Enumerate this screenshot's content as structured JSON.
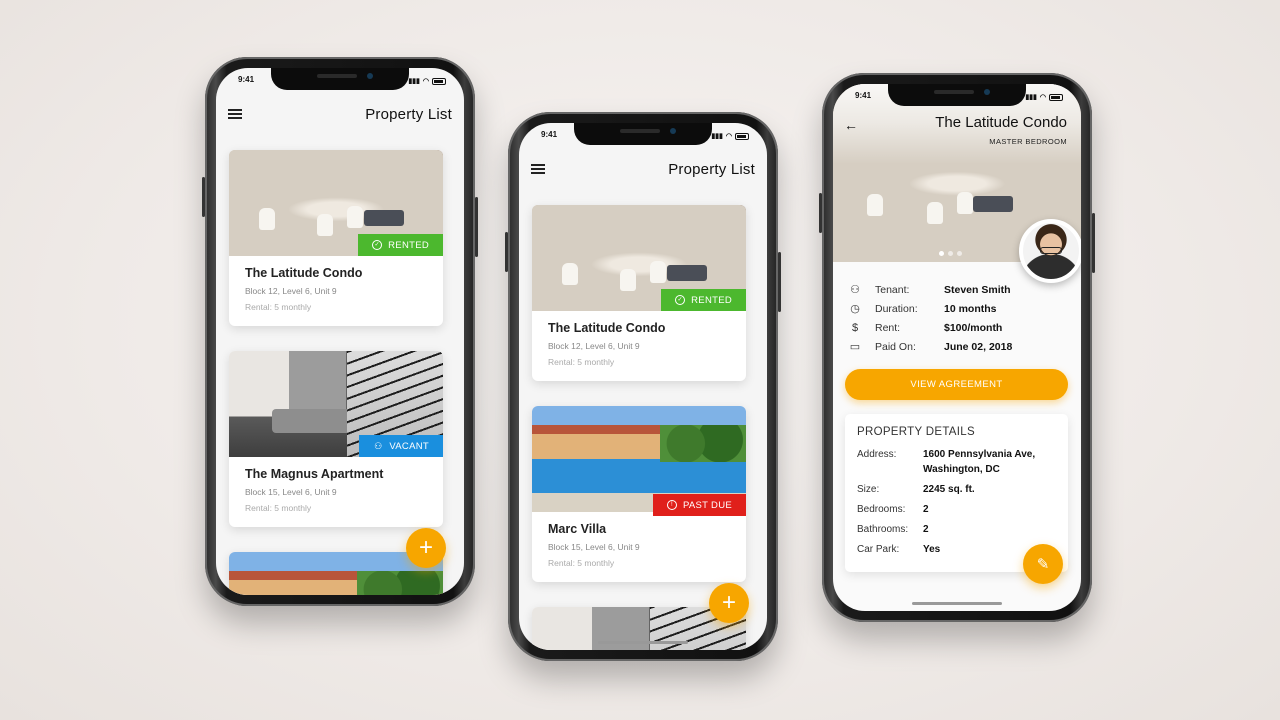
{
  "status_time": "9:41",
  "list_screen": {
    "title": "Property List",
    "cards": [
      {
        "name": "The Latitude Condo",
        "address": "Block 12, Level 6, Unit 9",
        "rental": "Rental: 5 monthly",
        "badge": "RENTED",
        "badge_color": "#4cb82e",
        "badge_icon": "check-circle-icon"
      },
      {
        "name": "The Magnus Apartment",
        "address": "Block 15, Level 6, Unit 9",
        "rental": "Rental: 5 monthly",
        "badge": "VACANT",
        "badge_color": "#1a8fde",
        "badge_icon": "person-icon"
      },
      {
        "name": "Marc Villa",
        "address": "Block 15, Level 6, Unit 9",
        "rental": "Rental: 5 monthly",
        "badge": "PAST DUE",
        "badge_color": "#e0201b",
        "badge_icon": "alert-circle-icon"
      }
    ],
    "fab_label": "+"
  },
  "detail_screen": {
    "title": "The Latitude Condo",
    "subtitle": "MASTER BEDROOM",
    "tenant": [
      {
        "label": "Tenant:",
        "value": "Steven Smith",
        "icon": "person-icon"
      },
      {
        "label": "Duration:",
        "value": "10 months",
        "icon": "clock-icon"
      },
      {
        "label": "Rent:",
        "value": "$100/month",
        "icon": "dollar-icon"
      },
      {
        "label": "Paid On:",
        "value": "June 02, 2018",
        "icon": "card-icon"
      }
    ],
    "button": "VIEW AGREEMENT",
    "details_heading": "PROPERTY DETAILS",
    "details": [
      {
        "label": "Address:",
        "value_line1": "1600 Pennsylvania Ave,",
        "value_line2": "Washington, DC"
      },
      {
        "label": "Size:",
        "value": "2245 sq. ft."
      },
      {
        "label": "Bedrooms:",
        "value": "2"
      },
      {
        "label": "Bathrooms:",
        "value": "2"
      },
      {
        "label": "Car Park:",
        "value": "Yes"
      }
    ],
    "accent": "#f7a600"
  }
}
